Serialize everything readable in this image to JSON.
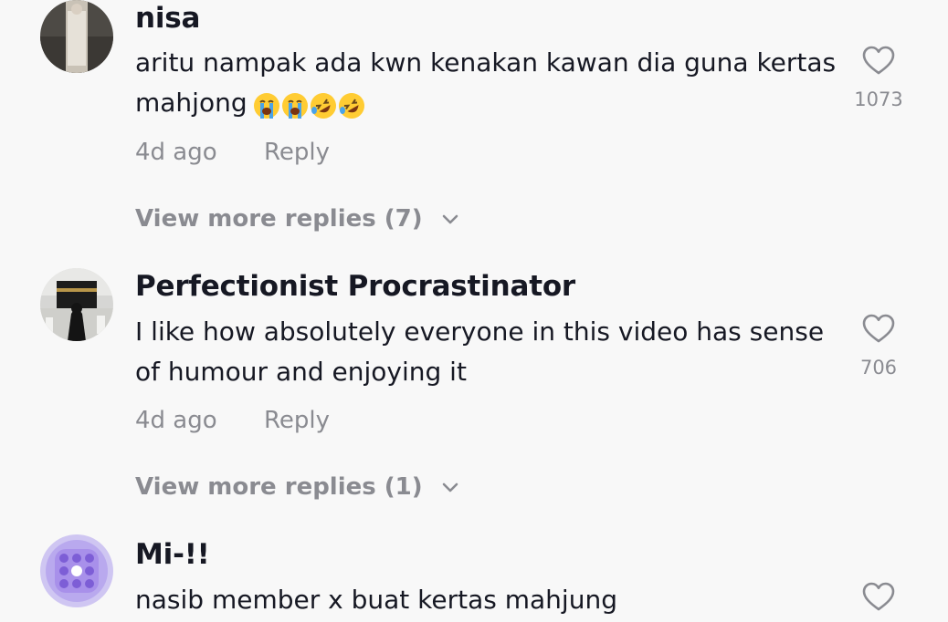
{
  "comments": [
    {
      "username": "nisa",
      "text": "aritu nampak ada kwn kenakan kawan dia guna kertas mahjong",
      "emojis": [
        "loudly-crying-face",
        "loudly-crying-face",
        "rolling-on-floor-laughing",
        "rolling-on-floor-laughing"
      ],
      "time": "4d ago",
      "reply_label": "Reply",
      "likes": "1073",
      "view_more": "View more replies (7)"
    },
    {
      "username": "Perfectionist Procrastinator",
      "text": "I like how absolutely everyone in this video has sense of humour and enjoying it",
      "time": "4d ago",
      "reply_label": "Reply",
      "likes": "706",
      "view_more": "View more replies (1)"
    },
    {
      "username": "Mi-!!",
      "text": "nasib member x buat kertas mahjung"
    }
  ],
  "icons": {
    "like": "heart-outline-icon",
    "expand": "chevron-down-icon"
  },
  "colors": {
    "background": "#f8f8f8",
    "primary_text": "#161823",
    "secondary_text": "#8a8b91"
  }
}
